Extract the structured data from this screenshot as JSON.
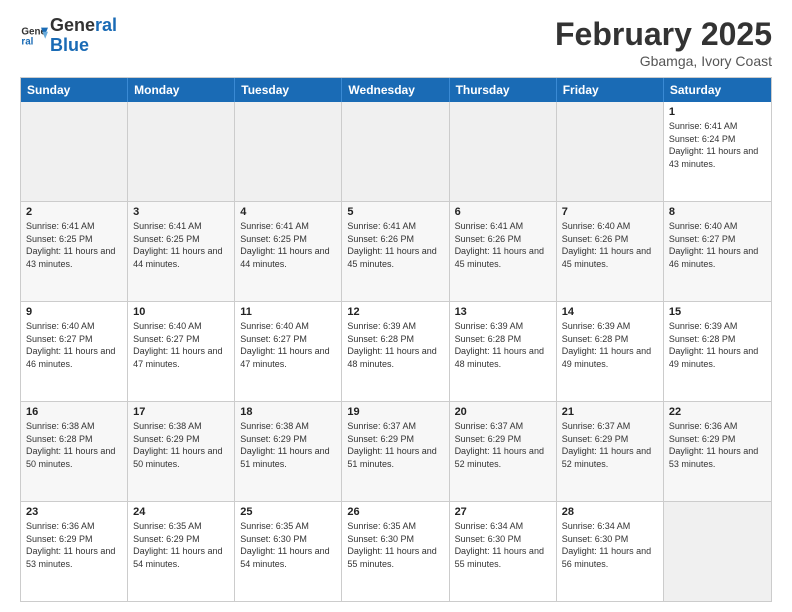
{
  "header": {
    "logo_line1": "General",
    "logo_line2": "Blue",
    "month": "February 2025",
    "location": "Gbamga, Ivory Coast"
  },
  "weekdays": [
    "Sunday",
    "Monday",
    "Tuesday",
    "Wednesday",
    "Thursday",
    "Friday",
    "Saturday"
  ],
  "rows": [
    [
      {
        "day": "",
        "info": ""
      },
      {
        "day": "",
        "info": ""
      },
      {
        "day": "",
        "info": ""
      },
      {
        "day": "",
        "info": ""
      },
      {
        "day": "",
        "info": ""
      },
      {
        "day": "",
        "info": ""
      },
      {
        "day": "1",
        "info": "Sunrise: 6:41 AM\nSunset: 6:24 PM\nDaylight: 11 hours and 43 minutes."
      }
    ],
    [
      {
        "day": "2",
        "info": "Sunrise: 6:41 AM\nSunset: 6:25 PM\nDaylight: 11 hours and 43 minutes."
      },
      {
        "day": "3",
        "info": "Sunrise: 6:41 AM\nSunset: 6:25 PM\nDaylight: 11 hours and 44 minutes."
      },
      {
        "day": "4",
        "info": "Sunrise: 6:41 AM\nSunset: 6:25 PM\nDaylight: 11 hours and 44 minutes."
      },
      {
        "day": "5",
        "info": "Sunrise: 6:41 AM\nSunset: 6:26 PM\nDaylight: 11 hours and 45 minutes."
      },
      {
        "day": "6",
        "info": "Sunrise: 6:41 AM\nSunset: 6:26 PM\nDaylight: 11 hours and 45 minutes."
      },
      {
        "day": "7",
        "info": "Sunrise: 6:40 AM\nSunset: 6:26 PM\nDaylight: 11 hours and 45 minutes."
      },
      {
        "day": "8",
        "info": "Sunrise: 6:40 AM\nSunset: 6:27 PM\nDaylight: 11 hours and 46 minutes."
      }
    ],
    [
      {
        "day": "9",
        "info": "Sunrise: 6:40 AM\nSunset: 6:27 PM\nDaylight: 11 hours and 46 minutes."
      },
      {
        "day": "10",
        "info": "Sunrise: 6:40 AM\nSunset: 6:27 PM\nDaylight: 11 hours and 47 minutes."
      },
      {
        "day": "11",
        "info": "Sunrise: 6:40 AM\nSunset: 6:27 PM\nDaylight: 11 hours and 47 minutes."
      },
      {
        "day": "12",
        "info": "Sunrise: 6:39 AM\nSunset: 6:28 PM\nDaylight: 11 hours and 48 minutes."
      },
      {
        "day": "13",
        "info": "Sunrise: 6:39 AM\nSunset: 6:28 PM\nDaylight: 11 hours and 48 minutes."
      },
      {
        "day": "14",
        "info": "Sunrise: 6:39 AM\nSunset: 6:28 PM\nDaylight: 11 hours and 49 minutes."
      },
      {
        "day": "15",
        "info": "Sunrise: 6:39 AM\nSunset: 6:28 PM\nDaylight: 11 hours and 49 minutes."
      }
    ],
    [
      {
        "day": "16",
        "info": "Sunrise: 6:38 AM\nSunset: 6:28 PM\nDaylight: 11 hours and 50 minutes."
      },
      {
        "day": "17",
        "info": "Sunrise: 6:38 AM\nSunset: 6:29 PM\nDaylight: 11 hours and 50 minutes."
      },
      {
        "day": "18",
        "info": "Sunrise: 6:38 AM\nSunset: 6:29 PM\nDaylight: 11 hours and 51 minutes."
      },
      {
        "day": "19",
        "info": "Sunrise: 6:37 AM\nSunset: 6:29 PM\nDaylight: 11 hours and 51 minutes."
      },
      {
        "day": "20",
        "info": "Sunrise: 6:37 AM\nSunset: 6:29 PM\nDaylight: 11 hours and 52 minutes."
      },
      {
        "day": "21",
        "info": "Sunrise: 6:37 AM\nSunset: 6:29 PM\nDaylight: 11 hours and 52 minutes."
      },
      {
        "day": "22",
        "info": "Sunrise: 6:36 AM\nSunset: 6:29 PM\nDaylight: 11 hours and 53 minutes."
      }
    ],
    [
      {
        "day": "23",
        "info": "Sunrise: 6:36 AM\nSunset: 6:29 PM\nDaylight: 11 hours and 53 minutes."
      },
      {
        "day": "24",
        "info": "Sunrise: 6:35 AM\nSunset: 6:29 PM\nDaylight: 11 hours and 54 minutes."
      },
      {
        "day": "25",
        "info": "Sunrise: 6:35 AM\nSunset: 6:30 PM\nDaylight: 11 hours and 54 minutes."
      },
      {
        "day": "26",
        "info": "Sunrise: 6:35 AM\nSunset: 6:30 PM\nDaylight: 11 hours and 55 minutes."
      },
      {
        "day": "27",
        "info": "Sunrise: 6:34 AM\nSunset: 6:30 PM\nDaylight: 11 hours and 55 minutes."
      },
      {
        "day": "28",
        "info": "Sunrise: 6:34 AM\nSunset: 6:30 PM\nDaylight: 11 hours and 56 minutes."
      },
      {
        "day": "",
        "info": ""
      }
    ]
  ]
}
